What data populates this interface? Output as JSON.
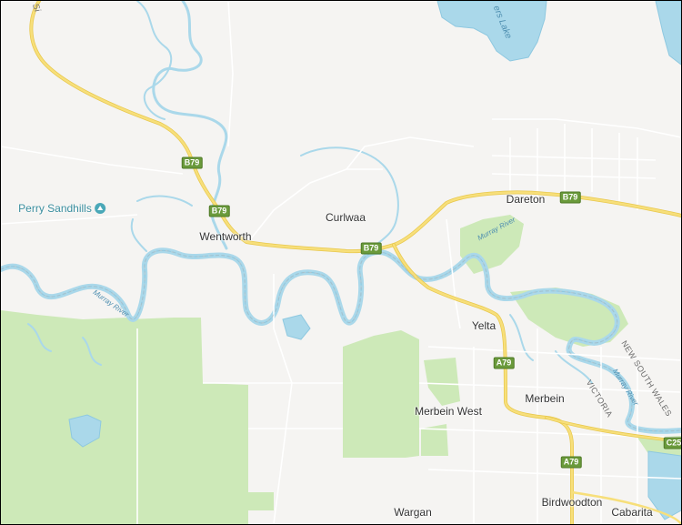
{
  "colors": {
    "land": "#f5f4f2",
    "park": "#cde9b8",
    "water": "#aad8ea",
    "water_edge": "#8ec8e0",
    "highway": "#f7df7a",
    "highway_edge": "#e8c84e",
    "minor_road": "#ffffff",
    "shield": "#6a9a3b"
  },
  "places": {
    "dareton": "Dareton",
    "curlwaa": "Curlwaa",
    "wentworth": "Wentworth",
    "yelta": "Yelta",
    "merbein": "Merbein",
    "merbein_west": "Merbein West",
    "wargan": "Wargan",
    "birdwoodton": "Birdwoodton",
    "cabarita": "Cabarita"
  },
  "poi": {
    "perry_sandhills": "Perry Sandhills"
  },
  "poi_icon": "landmark-icon",
  "route_shields": {
    "b79_a": "B79",
    "b79_b": "B79",
    "b79_c": "B79",
    "b79_d": "B79",
    "a79_a": "A79",
    "a79_b": "A79",
    "c25": "C25"
  },
  "water_labels": {
    "murray_west": "Murray River",
    "murray_east": "Murray River",
    "murray_south": "Murray River",
    "lake": "ers Lake",
    "road_top": "Si"
  },
  "states": {
    "nsw": "NEW SOUTH WALES",
    "vic": "VICTORIA"
  }
}
